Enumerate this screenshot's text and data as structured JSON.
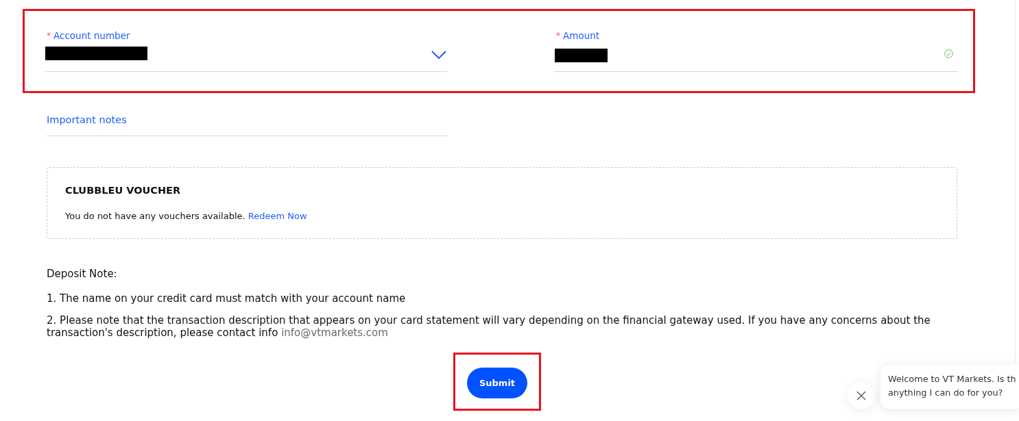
{
  "form": {
    "highlighted": true,
    "fields": [
      {
        "kind": "select",
        "required_mark": "*",
        "label": "Account number",
        "redacted": true
      },
      {
        "kind": "input",
        "required_mark": "*",
        "label": "Amount",
        "redacted": true,
        "valid": true
      }
    ]
  },
  "important_notes": {
    "label": "Important notes"
  },
  "voucher": {
    "title": "CLUBBLEU VOUCHER",
    "message": "You do not have any vouchers available.",
    "link": "Redeem Now"
  },
  "deposit_note": {
    "title": "Deposit Note:",
    "items": [
      {
        "text": "1. The name on your credit card must match with your account name"
      },
      {
        "text": "2. Please note that the transaction description that appears on your card statement will vary depending on the financial gateway used. If you have any concerns about the transaction's description, please contact info",
        "email": "info@vtmarkets.com"
      }
    ]
  },
  "submit": {
    "label": "Submit",
    "highlighted": true
  },
  "chat": {
    "message_lines": [
      "Welcome to VT Markets. Is th",
      "anything I can do for you?"
    ]
  }
}
